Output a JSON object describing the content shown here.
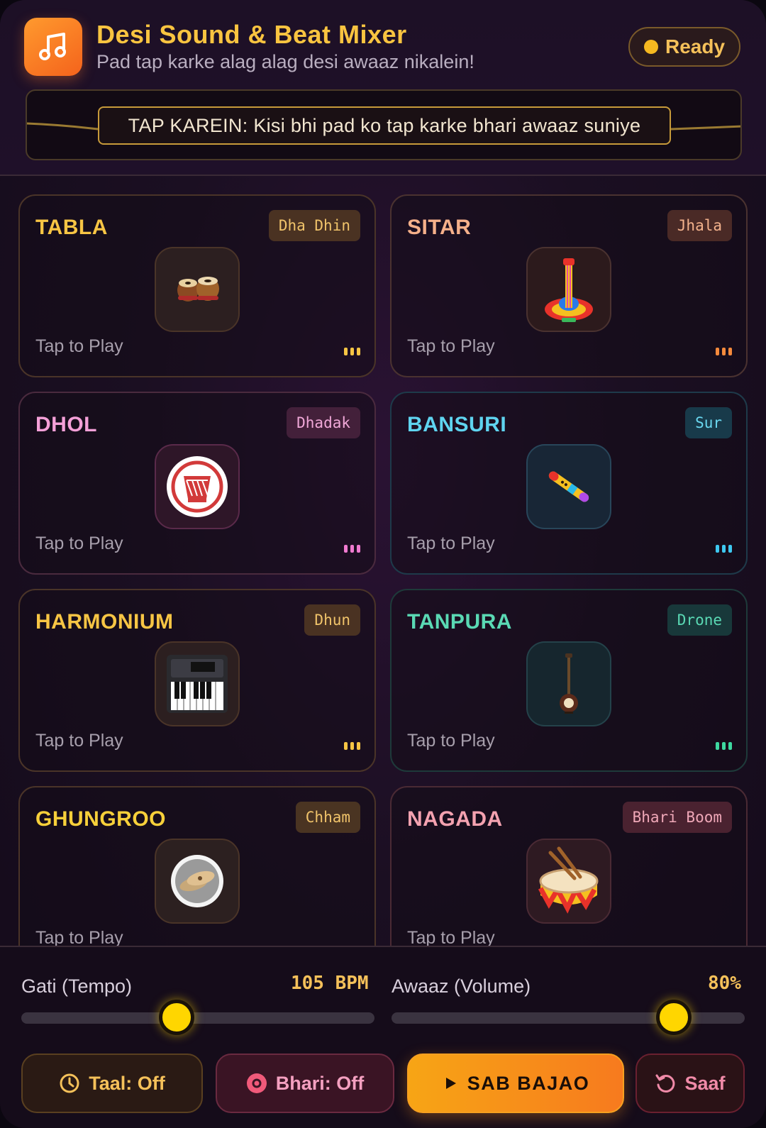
{
  "header": {
    "title": "Desi Sound & Beat Mixer",
    "subtitle": "Pad tap karke alag alag desi awaaz nikalein!",
    "status": "Ready",
    "banner": "TAP KAREIN: Kisi bhi pad ko tap karke bhari awaaz suniye"
  },
  "pads": [
    {
      "name": "TABLA",
      "tag": "Dha Dhin",
      "tap": "Tap to Play",
      "icon": "tabla-icon",
      "color": "#f7c544"
    },
    {
      "name": "SITAR",
      "tag": "Jhala",
      "tap": "Tap to Play",
      "icon": "sitar-icon",
      "color": "#f5b08a"
    },
    {
      "name": "DHOL",
      "tag": "Dhadak",
      "tap": "Tap to Play",
      "icon": "dhol-icon",
      "color": "#f4a0d8"
    },
    {
      "name": "BANSURI",
      "tag": "Sur",
      "tap": "Tap to Play",
      "icon": "flute-icon",
      "color": "#5fd4f0"
    },
    {
      "name": "HARMONIUM",
      "tag": "Dhun",
      "tap": "Tap to Play",
      "icon": "keyboard-icon",
      "color": "#f7c544"
    },
    {
      "name": "TANPURA",
      "tag": "Drone",
      "tap": "Tap to Play",
      "icon": "tanpura-icon",
      "color": "#5ad9b4"
    },
    {
      "name": "GHUNGROO",
      "tag": "Chham",
      "tap": "Tap to Play",
      "icon": "cymbal-icon",
      "color": "#f7d03a"
    },
    {
      "name": "NAGADA",
      "tag": "Bhari Boom",
      "tap": "Tap to Play",
      "icon": "drum-icon",
      "color": "#f4a2b0"
    }
  ],
  "controls": {
    "tempo_label": "Gati (Tempo)",
    "tempo_value": "105 BPM",
    "tempo_level": 0.44,
    "volume_label": "Awaaz (Volume)",
    "volume_value": "80%",
    "volume_level": 0.8
  },
  "buttons": {
    "taal": "Taal: Off",
    "bhari": "Bhari: Off",
    "play": "SAB BAJAO",
    "clear": "Saaf"
  }
}
